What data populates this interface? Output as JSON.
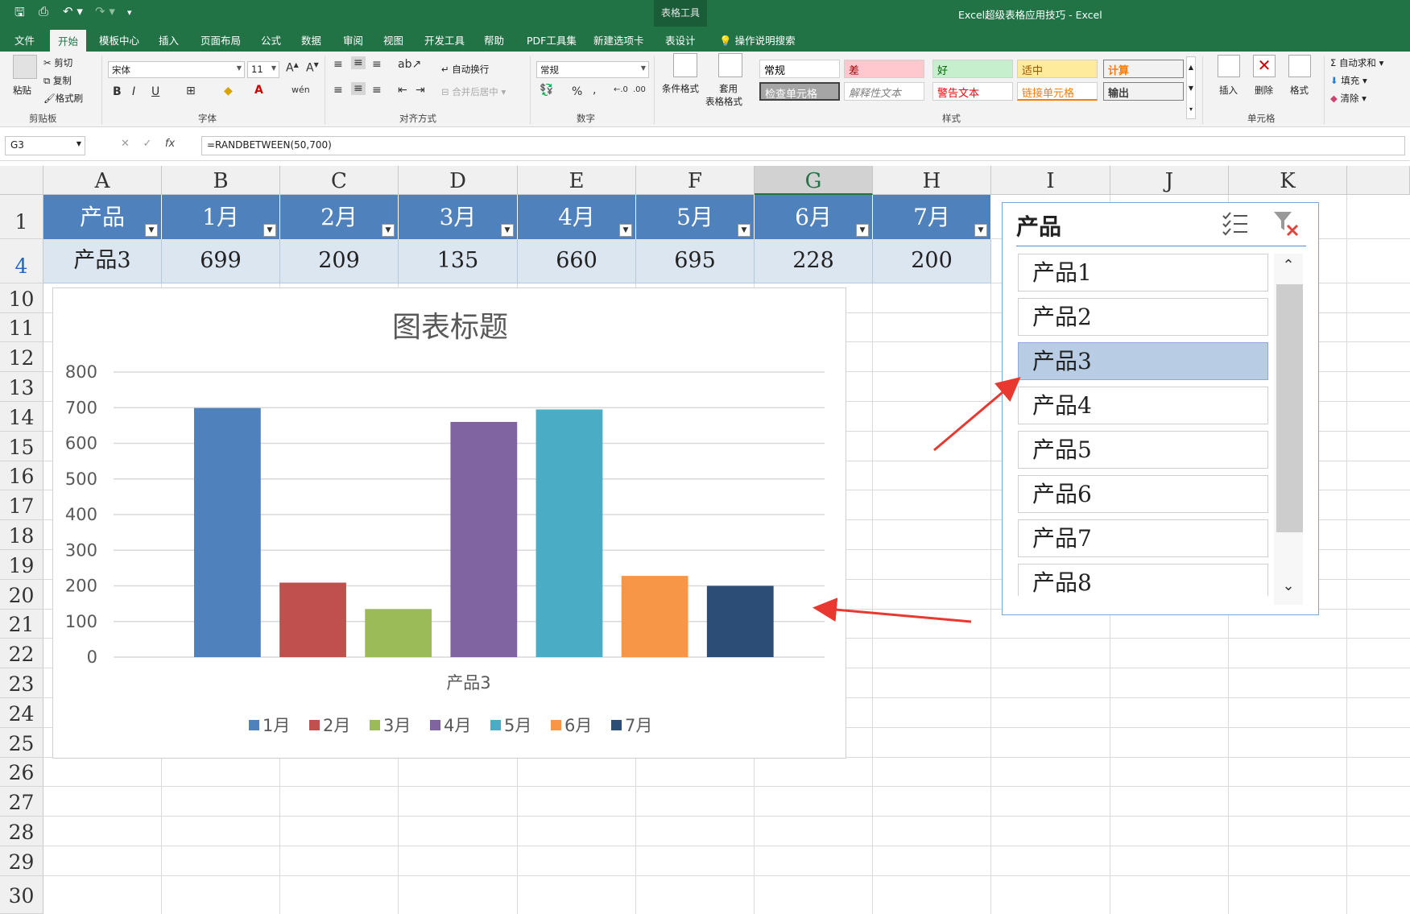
{
  "window": {
    "title": "Excel超级表格应用技巧  -  Excel",
    "context_group": "表格工具"
  },
  "tabs": [
    {
      "label": "文件"
    },
    {
      "label": "开始"
    },
    {
      "label": "模板中心"
    },
    {
      "label": "插入"
    },
    {
      "label": "页面布局"
    },
    {
      "label": "公式"
    },
    {
      "label": "数据"
    },
    {
      "label": "审阅"
    },
    {
      "label": "视图"
    },
    {
      "label": "开发工具"
    },
    {
      "label": "帮助"
    },
    {
      "label": "PDF工具集"
    },
    {
      "label": "新建选项卡"
    },
    {
      "label": "表设计"
    }
  ],
  "tell_me": "操作说明搜索",
  "ribbon": {
    "clipboard": {
      "paste": "粘贴",
      "cut": "剪切",
      "copy": "复制",
      "format_painter": "格式刷",
      "group": "剪贴板"
    },
    "font": {
      "name": "宋体",
      "size": "11",
      "group": "字体"
    },
    "alignment": {
      "wrap": "自动换行",
      "merge": "合并后居中",
      "group": "对齐方式"
    },
    "number": {
      "format": "常规",
      "group": "数字"
    },
    "styles": {
      "conditional": "条件格式",
      "table_format_1": "套用",
      "table_format_2": "表格格式",
      "group": "样式",
      "items": [
        {
          "label": "常规",
          "bg": "#ffffff",
          "fg": "#000000"
        },
        {
          "label": "差",
          "bg": "#ffc7ce",
          "fg": "#9c0006"
        },
        {
          "label": "好",
          "bg": "#c6efce",
          "fg": "#006100"
        },
        {
          "label": "适中",
          "bg": "#ffeb9c",
          "fg": "#9c5700"
        },
        {
          "label": "计算",
          "bg": "#f2f2f2",
          "fg": "#fa7d00"
        },
        {
          "label": "检查单元格",
          "bg": "#a5a5a5",
          "fg": "#ffffff"
        },
        {
          "label": "解释性文本",
          "bg": "#ffffff",
          "fg": "#7f7f7f"
        },
        {
          "label": "警告文本",
          "bg": "#ffffff",
          "fg": "#ff0000"
        },
        {
          "label": "链接单元格",
          "bg": "#ffffff",
          "fg": "#fa7d00"
        },
        {
          "label": "输出",
          "bg": "#f2f2f2",
          "fg": "#3f3f3f"
        }
      ]
    },
    "cells": {
      "insert": "插入",
      "delete": "删除",
      "format": "格式",
      "group": "单元格"
    },
    "editing": {
      "autosum": "自动求和",
      "fill": "填充",
      "clear": "清除"
    }
  },
  "formula_bar": {
    "name_box": "G3",
    "fx": "fx",
    "formula": "=RANDBETWEEN(50,700)"
  },
  "columns": [
    "A",
    "B",
    "C",
    "D",
    "E",
    "F",
    "G",
    "H",
    "I",
    "J",
    "K"
  ],
  "rows": [
    "1",
    "4",
    "10",
    "11",
    "12",
    "13",
    "14",
    "15",
    "16",
    "17",
    "18",
    "19",
    "20",
    "21",
    "22",
    "23",
    "24",
    "25",
    "26",
    "27",
    "28",
    "29",
    "30"
  ],
  "table": {
    "headers": [
      "产品",
      "1月",
      "2月",
      "3月",
      "4月",
      "5月",
      "6月",
      "7月"
    ],
    "row": [
      "产品3",
      "699",
      "209",
      "135",
      "660",
      "695",
      "228",
      "200"
    ]
  },
  "chart_data": {
    "type": "bar",
    "title": "图表标题",
    "categories": [
      "产品3"
    ],
    "xlabel": "产品3",
    "ylabel": "",
    "ylim": [
      0,
      800
    ],
    "yticks": [
      "0",
      "100",
      "200",
      "300",
      "400",
      "500",
      "600",
      "700",
      "800"
    ],
    "grid": true,
    "legend": "bottom",
    "series": [
      {
        "name": "1月",
        "values": [
          699
        ],
        "color": "#4f81bd"
      },
      {
        "name": "2月",
        "values": [
          209
        ],
        "color": "#c0504d"
      },
      {
        "name": "3月",
        "values": [
          135
        ],
        "color": "#9bbb59"
      },
      {
        "name": "4月",
        "values": [
          660
        ],
        "color": "#8064a2"
      },
      {
        "name": "5月",
        "values": [
          695
        ],
        "color": "#4bacc6"
      },
      {
        "name": "6月",
        "values": [
          228
        ],
        "color": "#f79646"
      },
      {
        "name": "7月",
        "values": [
          200
        ],
        "color": "#2c4d75"
      }
    ]
  },
  "slicer": {
    "title": "产品",
    "items": [
      {
        "label": "产品1",
        "selected": false
      },
      {
        "label": "产品2",
        "selected": false
      },
      {
        "label": "产品3",
        "selected": true
      },
      {
        "label": "产品4",
        "selected": false
      },
      {
        "label": "产品5",
        "selected": false
      },
      {
        "label": "产品6",
        "selected": false
      },
      {
        "label": "产品7",
        "selected": false
      },
      {
        "label": "产品8",
        "selected": false
      }
    ]
  }
}
